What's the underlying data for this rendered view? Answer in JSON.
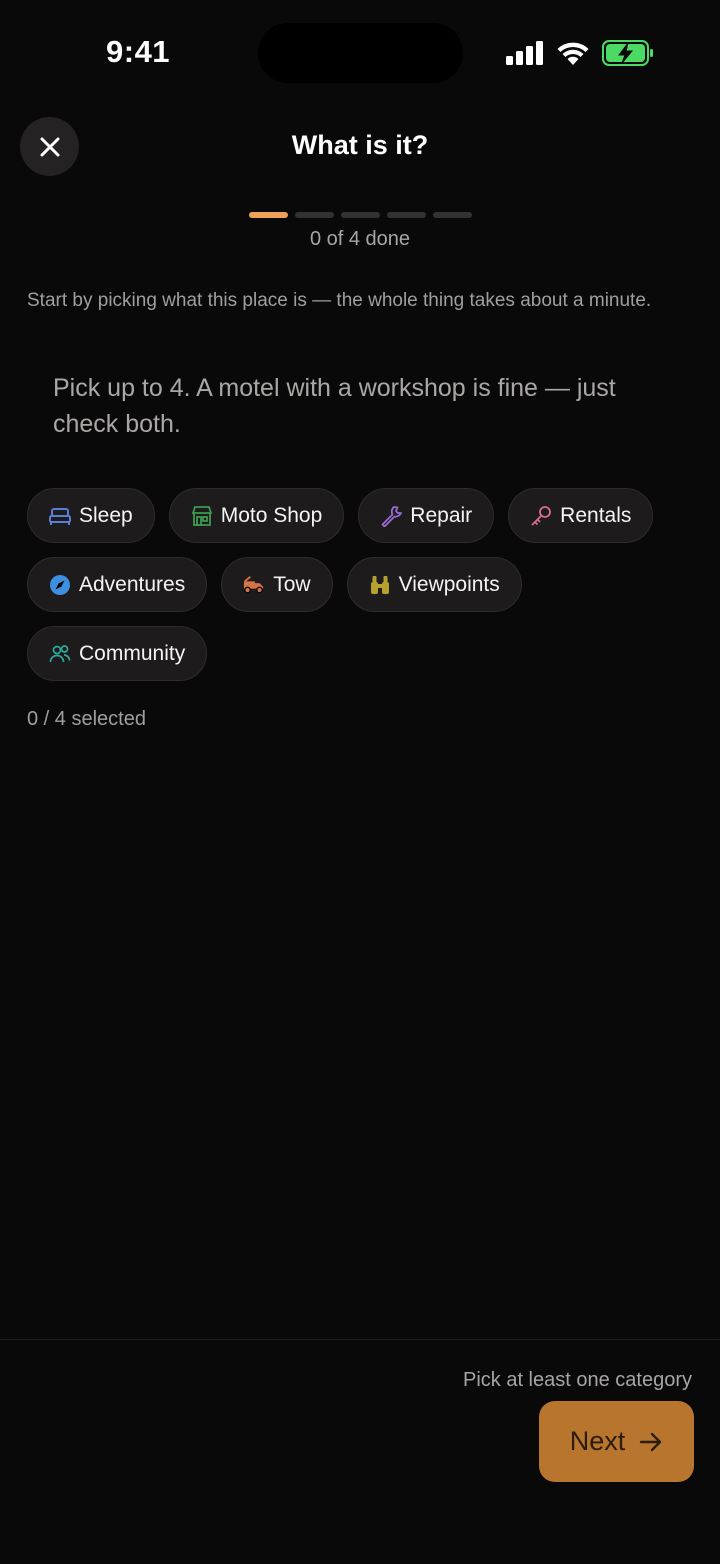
{
  "status_bar": {
    "time": "9:41"
  },
  "header": {
    "title": "What is it?"
  },
  "progress": {
    "steps_total": 5,
    "steps_active": 1,
    "label": "0 of 4 done"
  },
  "intro_text": "Start by picking what this place is — the whole thing takes about a minute.",
  "hint_text": "Pick up to 4. A motel with a workshop is fine — just check both.",
  "categories": [
    {
      "label": "Sleep",
      "icon": "bed-icon",
      "color": "#5b7fd6"
    },
    {
      "label": "Moto Shop",
      "icon": "storefront-icon",
      "color": "#3d9a4f"
    },
    {
      "label": "Repair",
      "icon": "wrench-icon",
      "color": "#9a6bd6"
    },
    {
      "label": "Rentals",
      "icon": "key-icon",
      "color": "#d66b93"
    },
    {
      "label": "Adventures",
      "icon": "compass-icon",
      "color": "#3f8fe0"
    },
    {
      "label": "Tow",
      "icon": "tow-truck-icon",
      "color": "#d9744a"
    },
    {
      "label": "Viewpoints",
      "icon": "binoculars-icon",
      "color": "#b7a12e"
    },
    {
      "label": "Community",
      "icon": "people-icon",
      "color": "#2fa89a"
    }
  ],
  "selected_count": "0 / 4 selected",
  "footer": {
    "hint": "Pick at least one category",
    "next_label": "Next"
  },
  "colors": {
    "accent": "#f0a356",
    "next_button": "#b8752e",
    "background": "#0a0909"
  }
}
